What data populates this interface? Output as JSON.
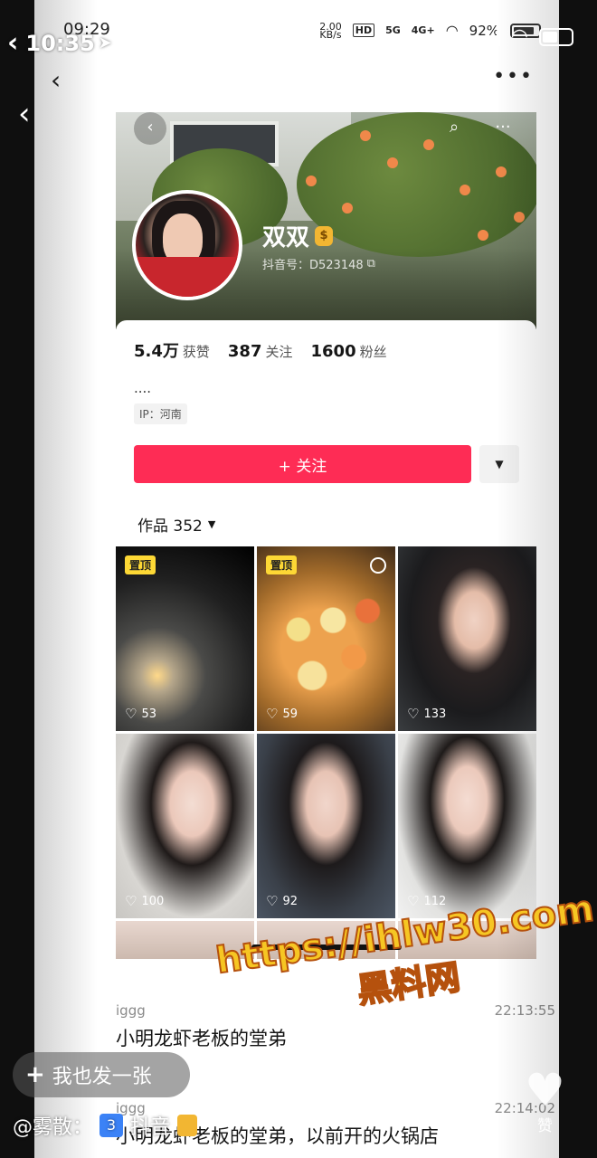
{
  "outer_status": {
    "time": "10:35",
    "location_icon": "navigation-arrow-icon"
  },
  "inner_status": {
    "time": "09:29",
    "net_speed_value": "2.00",
    "net_speed_unit": "KB/s",
    "hd": "HD",
    "g5": "5G",
    "g4": "4G+",
    "battery": "92%"
  },
  "profile": {
    "nickname": "双双",
    "badge_icon": "money-bag-icon",
    "douyin_id": "抖音号：D523148",
    "stats": [
      {
        "value": "5.4万",
        "label": "获赞"
      },
      {
        "value": "387",
        "label": "关注"
      },
      {
        "value": "1600",
        "label": "粉丝"
      }
    ],
    "bio": "....",
    "ip": "IP：河南",
    "follow_label": "+ 关注",
    "works_label": "作品 352"
  },
  "tiles": [
    {
      "pinned": "置顶",
      "likes": "53"
    },
    {
      "pinned": "置顶",
      "likes": "59"
    },
    {
      "pinned": "",
      "likes": "133"
    },
    {
      "pinned": "",
      "likes": "100"
    },
    {
      "pinned": "",
      "likes": "92"
    },
    {
      "pinned": "",
      "likes": "112"
    }
  ],
  "comments": [
    {
      "user": "iggg",
      "time": "22:13:55",
      "text": "小明龙虾老板的堂弟"
    },
    {
      "user": "iggg",
      "time": "22:14:02",
      "text": "小明龙虾老板的堂弟，以前开的火锅店"
    }
  ],
  "bottom": {
    "fab_label": "我也发一张",
    "tag_prefix": "@雾散：",
    "tag_num": "3",
    "tag_app": "抖音",
    "like_label": "赞"
  },
  "watermark": {
    "url": "https://ihlw30.com",
    "cn": "黑料网"
  }
}
